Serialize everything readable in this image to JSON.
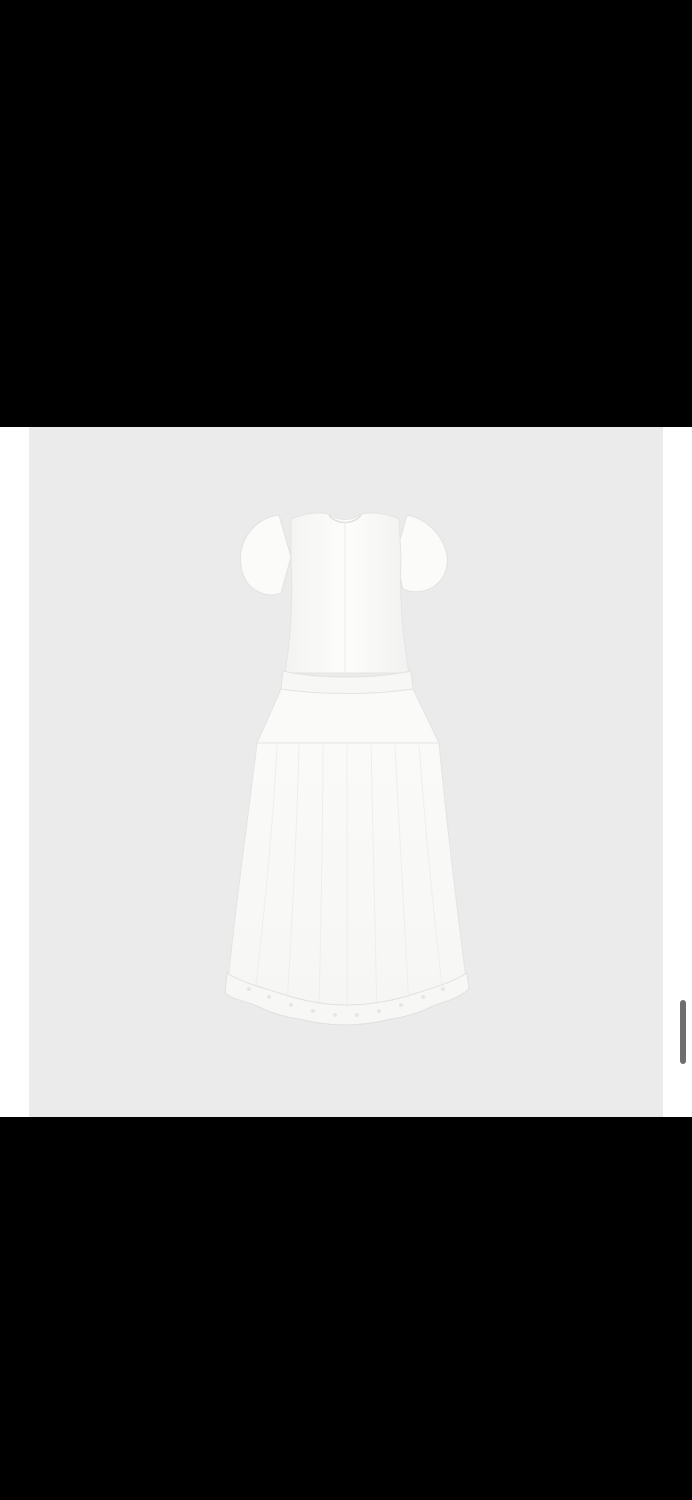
{
  "viewer": {
    "background_color": "#000000",
    "photo_background_color": "#ebebeb",
    "dress_color": "#fbfbf9",
    "scroll_indicator_color": "#6e6e6e"
  },
  "photo": {
    "subject": "product-image-dress"
  }
}
